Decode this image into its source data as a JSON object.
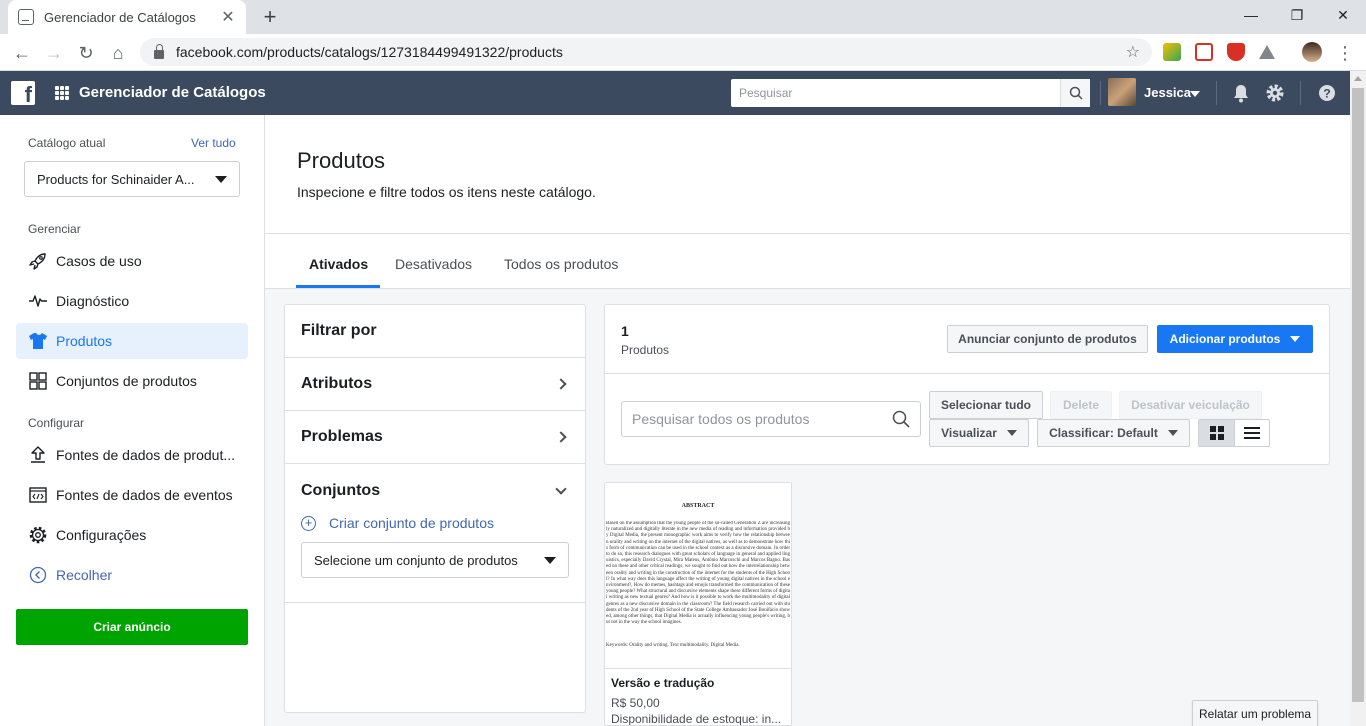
{
  "browser": {
    "tab_title": "Gerenciador de Catálogos",
    "url": "facebook.com/products/catalogs/1273184499491322/products"
  },
  "header": {
    "app_title": "Gerenciador de Catálogos",
    "search_placeholder": "Pesquisar",
    "user_name": "Jessica"
  },
  "sidebar": {
    "current_catalog_label": "Catálogo atual",
    "see_all": "Ver tudo",
    "catalog_name": "Products for Schinaider A...",
    "manage_label": "Gerenciar",
    "configure_label": "Configurar",
    "items": [
      {
        "label": "Casos de uso",
        "icon": "rocket-icon"
      },
      {
        "label": "Diagnóstico",
        "icon": "pulse-icon"
      },
      {
        "label": "Produtos",
        "icon": "shirt-icon",
        "active": true
      },
      {
        "label": "Conjuntos de produtos",
        "icon": "grid-icon"
      },
      {
        "label": "Fontes de dados de produt...",
        "icon": "upload-icon"
      },
      {
        "label": "Fontes de dados de eventos",
        "icon": "code-icon"
      },
      {
        "label": "Configurações",
        "icon": "gear-icon"
      },
      {
        "label": "Recolher",
        "icon": "collapse-icon"
      }
    ],
    "create_ad": "Criar anúncio"
  },
  "page": {
    "title": "Produtos",
    "subtitle": "Inspecione e filtre todos os itens neste catálogo.",
    "tabs": [
      "Ativados",
      "Desativados",
      "Todos os produtos"
    ]
  },
  "filters": {
    "title": "Filtrar por",
    "attributes": "Atributos",
    "problems": "Problemas",
    "sets": "Conjuntos",
    "create_set": "Criar conjunto de produtos",
    "select_set": "Selecione um conjunto de produtos"
  },
  "results": {
    "count": "1",
    "count_label": "Produtos",
    "advertise_set": "Anunciar conjunto de produtos",
    "add_products": "Adicionar produtos",
    "search_placeholder": "Pesquisar todos os produtos",
    "select_all": "Selecionar tudo",
    "delete": "Delete",
    "deactivate": "Desativar veiculação",
    "view": "Visualizar",
    "sort": "Classificar: Default"
  },
  "product": {
    "name": "Versão e tradução",
    "price": "R$ 50,00",
    "stock": "Disponibilidade de estoque: in...",
    "thumb_title": "ABSTRACT",
    "thumb_body": "Based on the assumption that the young people of the so-called Generation Z are increasingly naturalized and digitally literate in the new media of reading and information provided by Digital Media, the present monographic work aims to verify how the relationship between orality and writing on the internet of the digital natives, as well as to demonstrate how this form of communication can be used in the school context as a discursive domain. In order to do so, this research dialogues with great scholars of language in general and applied linguistics, especially David Crystal, Mira Mateus, Antônio Marcuschi and Marcos Bagno. Based on these and other critical readings, we sought to find out how the interrelationship between orality and writing in the construction of the internet for the students of the High School? In what way does this language affect the writing of young digital natives in the school environment?, How do memes, hashtags and emojis transformed the communication of these young people? What structural and discursive elements shape these different forms of digital writing as new textual genres? And how is it possible to work the multimodality of digital genres as a new discursive domain in the classroom? The field research carried out with students of the 2nd year of High School of the State College Ambassador José Bonifácio showed, among other things, that Digital Media is actually influencing young people's writing, but not in the way the school imagines.",
    "thumb_keywords": "Keywords: Orality and writing. Text multimodality. Digital Media."
  },
  "footer": {
    "report": "Relatar um problema"
  }
}
